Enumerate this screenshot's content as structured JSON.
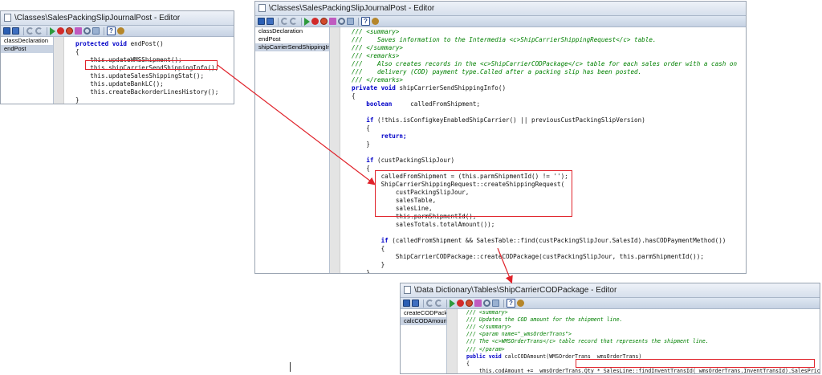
{
  "windows": [
    {
      "title": "\\Classes\\SalesPackingSlipJournalPost - Editor",
      "methods": [
        {
          "label": "classDeclaration",
          "selected": false
        },
        {
          "label": "endPost",
          "selected": true
        }
      ],
      "code_lines": [
        {
          "segments": [
            {
              "t": "protected void ",
              "k": "kw"
            },
            {
              "t": "endPost()",
              "k": ""
            }
          ]
        },
        {
          "segments": [
            {
              "t": "{",
              "k": ""
            }
          ]
        },
        {
          "segments": [
            {
              "t": "    this.updateWMSShipment();",
              "k": ""
            }
          ]
        },
        {
          "segments": [
            {
              "t": "    this.shipCarrierSendShippingInfo();",
              "k": ""
            }
          ]
        },
        {
          "segments": [
            {
              "t": "    this.updateSalesShippingStat();",
              "k": ""
            }
          ]
        },
        {
          "segments": [
            {
              "t": "    this.updateBankLC();",
              "k": ""
            }
          ]
        },
        {
          "segments": [
            {
              "t": "    this.createBackorderLinesHistory();",
              "k": ""
            }
          ]
        },
        {
          "segments": [
            {
              "t": "}",
              "k": ""
            }
          ]
        }
      ]
    },
    {
      "title": "\\Classes\\SalesPackingSlipJournalPost - Editor",
      "methods": [
        {
          "label": "classDeclaration",
          "selected": false
        },
        {
          "label": "endPost",
          "selected": false
        },
        {
          "label": "shipCarrierSendShippingInfo",
          "selected": true
        }
      ],
      "code_lines": [
        {
          "segments": [
            {
              "t": "/// <summary>",
              "k": "cm"
            }
          ]
        },
        {
          "segments": [
            {
              "t": "///    Saves information to the Intermedia <c>ShipCarrierShippingRequest</c> table.",
              "k": "cm"
            }
          ]
        },
        {
          "segments": [
            {
              "t": "/// </summary>",
              "k": "cm"
            }
          ]
        },
        {
          "segments": [
            {
              "t": "/// <remarks>",
              "k": "cm"
            }
          ]
        },
        {
          "segments": [
            {
              "t": "///    Also creates records in the <c>ShipCarrierCODPackage</c> table for each sales order with a cash on",
              "k": "cm"
            }
          ]
        },
        {
          "segments": [
            {
              "t": "///    delivery (COD) payment type.Called after a packing slip has been posted.",
              "k": "cm"
            }
          ]
        },
        {
          "segments": [
            {
              "t": "/// </remarks>",
              "k": "cm"
            }
          ]
        },
        {
          "segments": [
            {
              "t": "private void ",
              "k": "kw"
            },
            {
              "t": "shipCarrierSendShippingInfo()",
              "k": ""
            }
          ]
        },
        {
          "segments": [
            {
              "t": "{",
              "k": ""
            }
          ]
        },
        {
          "segments": [
            {
              "t": "    ",
              "k": ""
            },
            {
              "t": "boolean",
              "k": "kw"
            },
            {
              "t": "     calledFromShipment;",
              "k": ""
            }
          ]
        },
        {
          "segments": [
            {
              "t": "",
              "k": ""
            }
          ]
        },
        {
          "segments": [
            {
              "t": "    ",
              "k": ""
            },
            {
              "t": "if",
              "k": "kw"
            },
            {
              "t": " (!this.isConfigkeyEnabledShipCarrier() || previousCustPackingSlipVersion)",
              "k": ""
            }
          ]
        },
        {
          "segments": [
            {
              "t": "    {",
              "k": ""
            }
          ]
        },
        {
          "segments": [
            {
              "t": "        ",
              "k": ""
            },
            {
              "t": "return;",
              "k": "kw"
            }
          ]
        },
        {
          "segments": [
            {
              "t": "    }",
              "k": ""
            }
          ]
        },
        {
          "segments": [
            {
              "t": "",
              "k": ""
            }
          ]
        },
        {
          "segments": [
            {
              "t": "    ",
              "k": ""
            },
            {
              "t": "if",
              "k": "kw"
            },
            {
              "t": " (custPackingSlipJour)",
              "k": ""
            }
          ]
        },
        {
          "segments": [
            {
              "t": "    {",
              "k": ""
            }
          ]
        },
        {
          "segments": [
            {
              "t": "        calledFromShipment = (this.parmShipmentId() != '');",
              "k": ""
            }
          ]
        },
        {
          "segments": [
            {
              "t": "        ShipCarrierShippingRequest::createShippingRequest(",
              "k": ""
            }
          ]
        },
        {
          "segments": [
            {
              "t": "            custPackingSlipJour,",
              "k": ""
            }
          ]
        },
        {
          "segments": [
            {
              "t": "            salesTable,",
              "k": ""
            }
          ]
        },
        {
          "segments": [
            {
              "t": "            salesLine,",
              "k": ""
            }
          ]
        },
        {
          "segments": [
            {
              "t": "            this.parmShipmentId(),",
              "k": ""
            }
          ]
        },
        {
          "segments": [
            {
              "t": "            salesTotals.totalAmount());",
              "k": ""
            }
          ]
        },
        {
          "segments": [
            {
              "t": "",
              "k": ""
            }
          ]
        },
        {
          "segments": [
            {
              "t": "        ",
              "k": ""
            },
            {
              "t": "if",
              "k": "kw"
            },
            {
              "t": " (calledFromShipment && SalesTable::find(custPackingSlipJour.SalesId).hasCODPaymentMethod())",
              "k": ""
            }
          ]
        },
        {
          "segments": [
            {
              "t": "        {",
              "k": ""
            }
          ]
        },
        {
          "segments": [
            {
              "t": "            ShipCarrierCODPackage::createCODPackage(custPackingSlipJour, this.parmShipmentId());",
              "k": ""
            }
          ]
        },
        {
          "segments": [
            {
              "t": "        }",
              "k": ""
            }
          ]
        },
        {
          "segments": [
            {
              "t": "    }",
              "k": ""
            }
          ]
        },
        {
          "segments": [
            {
              "t": "}",
              "k": ""
            }
          ]
        }
      ]
    },
    {
      "title": "\\Data Dictionary\\Tables\\ShipCarrierCODPackage - Editor",
      "methods": [
        {
          "label": "createCODPackage",
          "selected": false
        },
        {
          "label": "calcCODAmount",
          "selected": true
        }
      ],
      "code_lines": [
        {
          "segments": [
            {
              "t": "/// <summary>",
              "k": "cm"
            }
          ]
        },
        {
          "segments": [
            {
              "t": "/// Updates the COD amount for the shipment line.",
              "k": "cm"
            }
          ]
        },
        {
          "segments": [
            {
              "t": "/// </summary>",
              "k": "cm"
            }
          ]
        },
        {
          "segments": [
            {
              "t": "/// <param name=\"_wmsOrderTrans\">",
              "k": "cm"
            }
          ]
        },
        {
          "segments": [
            {
              "t": "/// The <c>WMSOrderTrans</c> table record that represents the shipment line.",
              "k": "cm"
            }
          ]
        },
        {
          "segments": [
            {
              "t": "/// </param>",
              "k": "cm"
            }
          ]
        },
        {
          "segments": [
            {
              "t": "public void ",
              "k": "kw"
            },
            {
              "t": "calcCODAmount(WMSOrderTrans _wmsOrderTrans)",
              "k": ""
            }
          ]
        },
        {
          "segments": [
            {
              "t": "{",
              "k": ""
            }
          ]
        },
        {
          "segments": [
            {
              "t": "    this.codAmount += _wmsOrderTrans.Qty * SalesLine::findInventTransId(_wmsOrderTrans.InventTransId).SalesPrice;",
              "k": ""
            }
          ]
        },
        {
          "segments": [
            {
              "t": "}",
              "k": ""
            }
          ]
        }
      ]
    }
  ]
}
